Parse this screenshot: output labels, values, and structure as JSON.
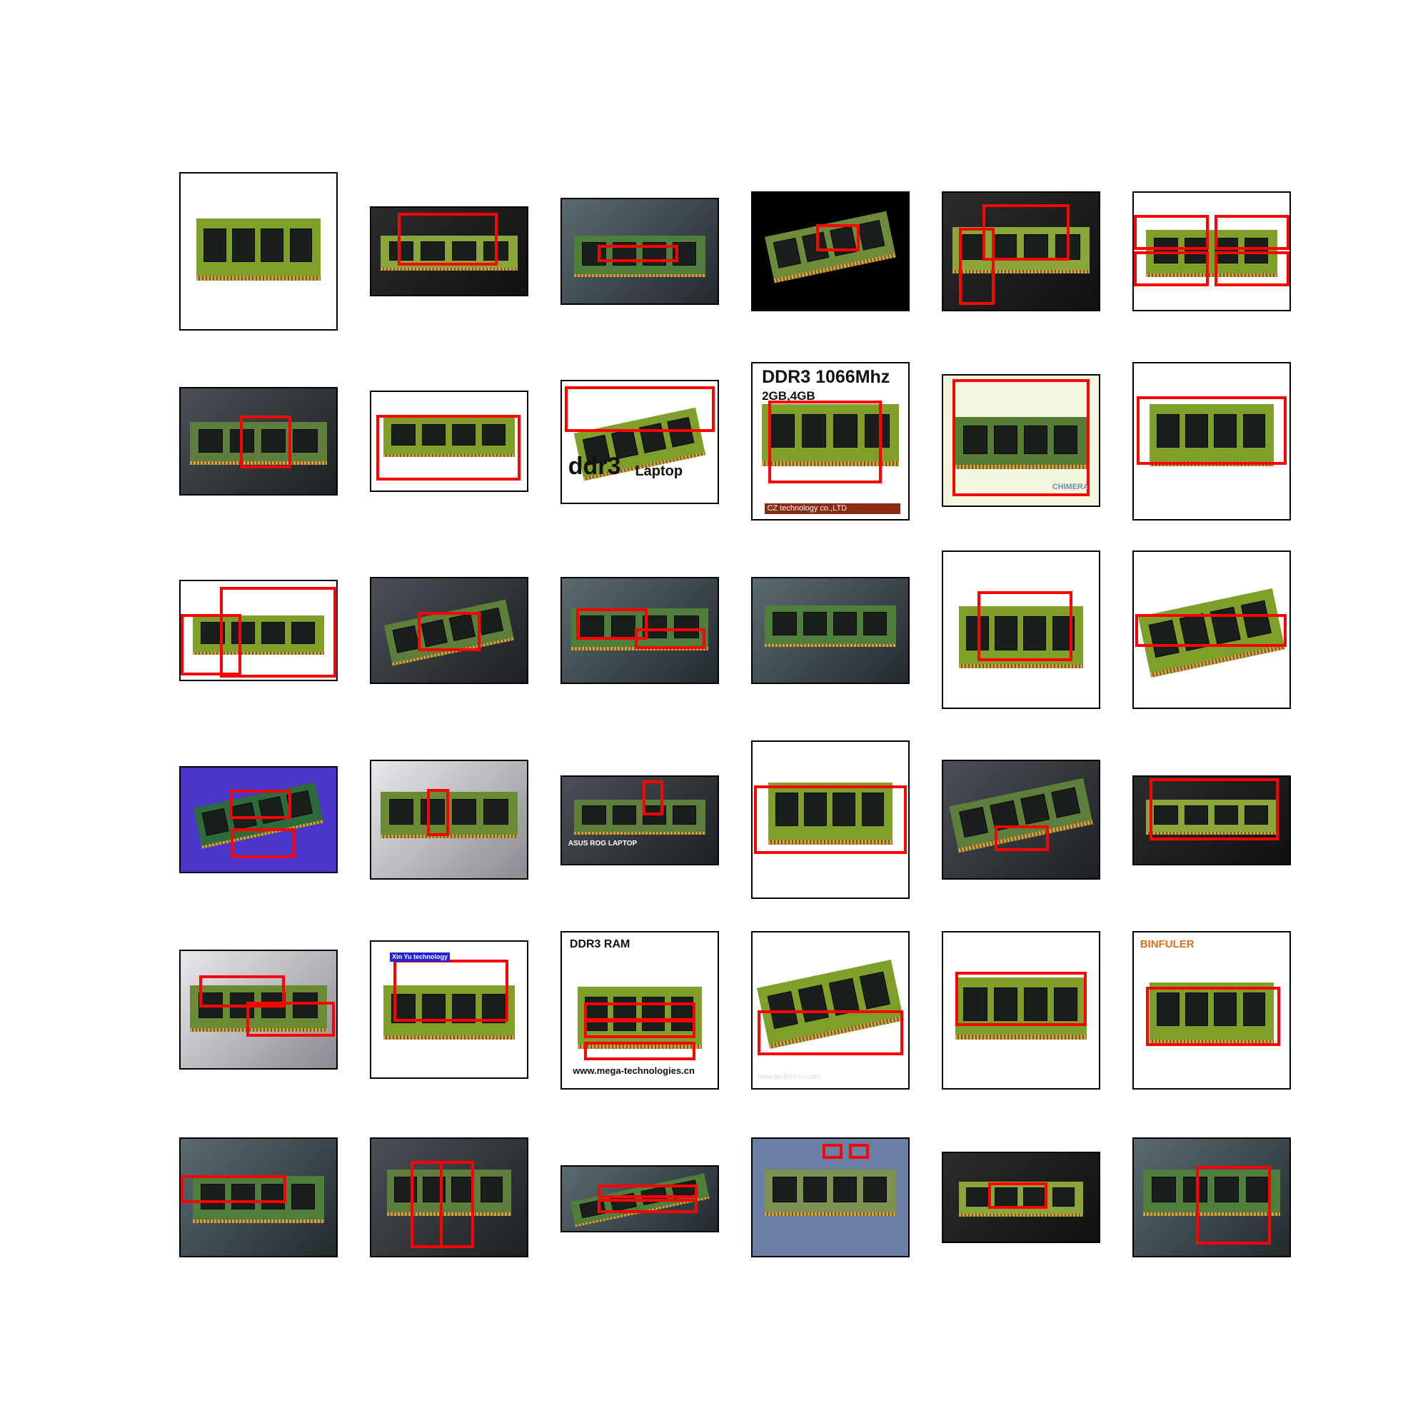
{
  "figure": {
    "tile_count": 36,
    "bbox_color": "#ff0000",
    "subject": "RAM memory modules"
  },
  "tiles": [
    {
      "row": 1,
      "col": 1,
      "style": "light",
      "texts": []
    },
    {
      "row": 1,
      "col": 2,
      "style": "dark",
      "texts": []
    },
    {
      "row": 1,
      "col": 3,
      "style": "motherboard",
      "texts": []
    },
    {
      "row": 1,
      "col": 4,
      "style": "black",
      "texts": []
    },
    {
      "row": 1,
      "col": 5,
      "style": "dark",
      "texts": []
    },
    {
      "row": 1,
      "col": 6,
      "style": "light",
      "texts": []
    },
    {
      "row": 2,
      "col": 1,
      "style": "laptop",
      "texts": []
    },
    {
      "row": 2,
      "col": 2,
      "style": "light",
      "texts": []
    },
    {
      "row": 2,
      "col": 3,
      "style": "light",
      "texts": [
        "ddr3",
        "Laptop"
      ]
    },
    {
      "row": 2,
      "col": 4,
      "style": "light",
      "texts": [
        "DDR3 1066Mhz",
        "2GB,4GB",
        "CZ technology co.,LTD"
      ]
    },
    {
      "row": 2,
      "col": 5,
      "style": "cream",
      "texts": [
        "CHIMERA"
      ]
    },
    {
      "row": 2,
      "col": 6,
      "style": "light",
      "texts": []
    },
    {
      "row": 3,
      "col": 1,
      "style": "light",
      "texts": []
    },
    {
      "row": 3,
      "col": 2,
      "style": "laptop",
      "texts": []
    },
    {
      "row": 3,
      "col": 3,
      "style": "motherboard",
      "texts": []
    },
    {
      "row": 3,
      "col": 4,
      "style": "motherboard",
      "texts": []
    },
    {
      "row": 3,
      "col": 5,
      "style": "light",
      "texts": []
    },
    {
      "row": 3,
      "col": 6,
      "style": "light",
      "texts": []
    },
    {
      "row": 4,
      "col": 1,
      "style": "purple",
      "texts": []
    },
    {
      "row": 4,
      "col": 2,
      "style": "grey",
      "texts": []
    },
    {
      "row": 4,
      "col": 3,
      "style": "laptop",
      "texts": [
        "ASUS ROG LAPTOP"
      ]
    },
    {
      "row": 4,
      "col": 4,
      "style": "light",
      "texts": []
    },
    {
      "row": 4,
      "col": 5,
      "style": "laptop",
      "texts": []
    },
    {
      "row": 4,
      "col": 6,
      "style": "dark",
      "texts": []
    },
    {
      "row": 5,
      "col": 1,
      "style": "grey",
      "texts": []
    },
    {
      "row": 5,
      "col": 2,
      "style": "light",
      "texts": [
        "Xin Yu technology"
      ]
    },
    {
      "row": 5,
      "col": 3,
      "style": "light",
      "texts": [
        "DDR3 RAM",
        "www.mega-technologies.cn"
      ]
    },
    {
      "row": 5,
      "col": 4,
      "style": "light",
      "texts": [
        "16GB Taiwan 2133Mhz DDR4",
        "www.wellbricks.com"
      ]
    },
    {
      "row": 5,
      "col": 5,
      "style": "light",
      "texts": []
    },
    {
      "row": 5,
      "col": 6,
      "style": "light",
      "texts": [
        "BINFULER"
      ]
    },
    {
      "row": 6,
      "col": 1,
      "style": "motherboard",
      "texts": []
    },
    {
      "row": 6,
      "col": 2,
      "style": "laptop",
      "texts": []
    },
    {
      "row": 6,
      "col": 3,
      "style": "motherboard",
      "texts": []
    },
    {
      "row": 6,
      "col": 4,
      "style": "board-blue",
      "texts": []
    },
    {
      "row": 6,
      "col": 5,
      "style": "dark",
      "texts": []
    },
    {
      "row": 6,
      "col": 6,
      "style": "motherboard",
      "texts": []
    }
  ]
}
